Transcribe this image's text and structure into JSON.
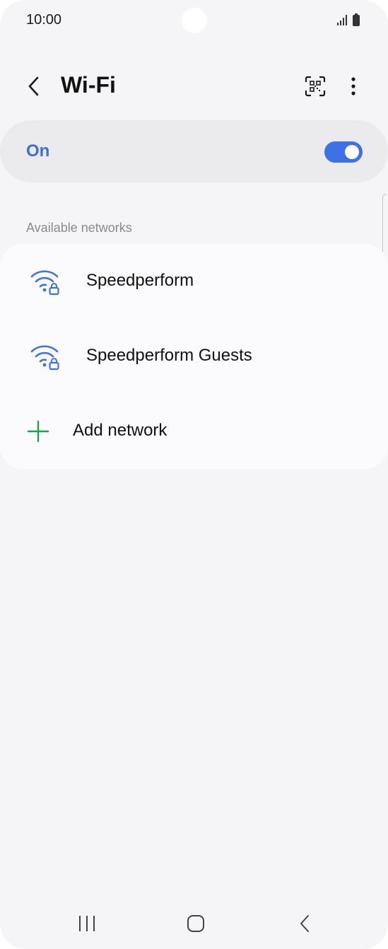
{
  "status_bar": {
    "time": "10:00",
    "icons": [
      "signal-icon",
      "battery-icon"
    ]
  },
  "header": {
    "title": "Wi-Fi",
    "back_icon": "chevron-left-icon",
    "qr_icon": "qr-scan-icon",
    "more_icon": "more-vert-icon"
  },
  "master_toggle": {
    "label": "On",
    "checked": true
  },
  "available_networks": {
    "header": "Available networks",
    "items": [
      {
        "ssid": "Speedperform",
        "icon": "wifi-lock-icon"
      },
      {
        "ssid": "Speedperform Guests",
        "icon": "wifi-lock-icon"
      }
    ],
    "add_network": {
      "label": "Add network",
      "icon": "plus-icon"
    }
  },
  "nav_bar": {
    "buttons": [
      "recents-icon",
      "home-icon",
      "back-icon"
    ]
  },
  "colors": {
    "accent": "#3e72e4",
    "add_green": "#1aa34a",
    "background": "#f5f5f8"
  }
}
